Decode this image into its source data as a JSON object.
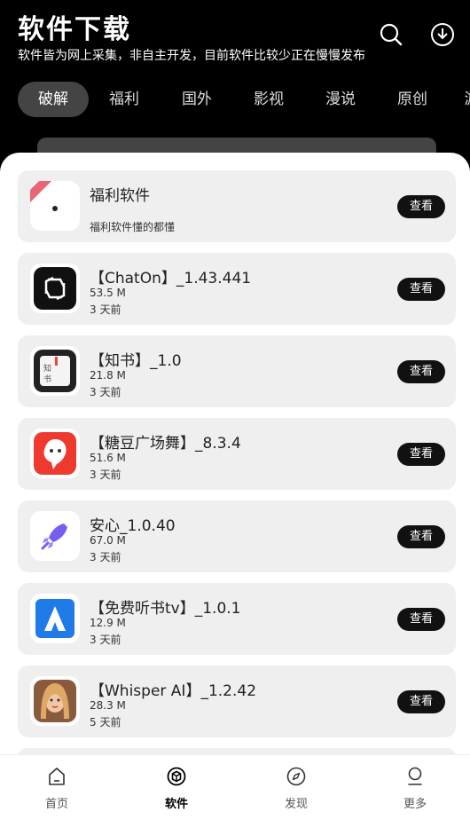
{
  "header": {
    "title": "软件下载",
    "subtitle": "软件皆为网上采集，非自主开发，目前软件比较少正在慢慢发布",
    "search_icon": "search-icon",
    "download_icon": "download-icon"
  },
  "tabs": [
    {
      "label": "破解",
      "active": true
    },
    {
      "label": "福利"
    },
    {
      "label": "国外"
    },
    {
      "label": "影视"
    },
    {
      "label": "漫说"
    },
    {
      "label": "原创"
    },
    {
      "label": "游"
    }
  ],
  "apps": [
    {
      "title": "福利软件",
      "desc": "福利软件懂的都懂",
      "button": "查看",
      "icon": "fuli-icon"
    },
    {
      "title": "【ChatOn】_1.43.441",
      "size": "53.5 M",
      "time": "3 天前",
      "button": "查看",
      "icon": "chaton-icon"
    },
    {
      "title": "【知书】_1.0",
      "size": "21.8 M",
      "time": "3 天前",
      "button": "查看",
      "icon": "zhishu-icon"
    },
    {
      "title": "【糖豆广场舞】_8.3.4",
      "size": "51.6 M",
      "time": "3 天前",
      "button": "查看",
      "icon": "tangdou-icon"
    },
    {
      "title": "安心_1.0.40",
      "size": "67.0 M",
      "time": "3 天前",
      "button": "查看",
      "icon": "rocket-icon"
    },
    {
      "title": "【免费听书tv】_1.0.1",
      "size": "12.9 M",
      "time": "3 天前",
      "button": "查看",
      "icon": "tingshu-icon"
    },
    {
      "title": "【Whisper AI】_1.2.42",
      "size": "28.3 M",
      "time": "5 天前",
      "button": "查看",
      "icon": "whisper-icon"
    }
  ],
  "bottom_nav": [
    {
      "label": "首页",
      "icon": "home-icon"
    },
    {
      "label": "软件",
      "icon": "box-icon",
      "active": true
    },
    {
      "label": "发现",
      "icon": "compass-icon"
    },
    {
      "label": "更多",
      "icon": "user-icon"
    }
  ]
}
